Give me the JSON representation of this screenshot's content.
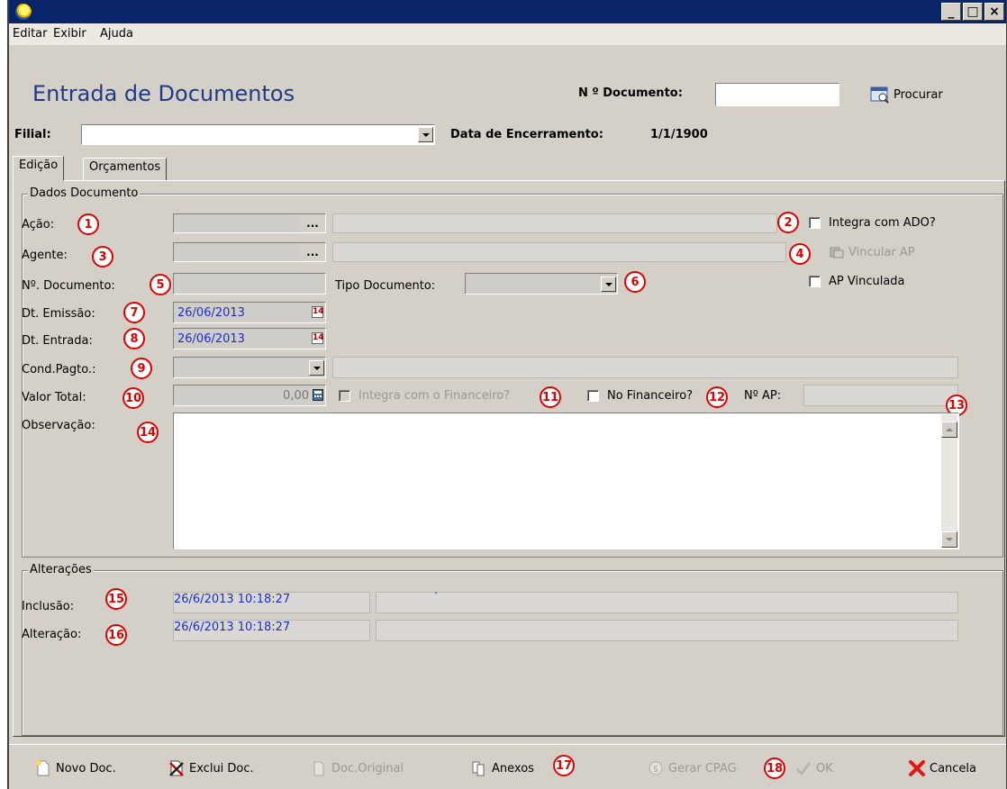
{
  "window": {
    "controls": [
      "_",
      "□",
      "×"
    ]
  },
  "menu": {
    "items": [
      "Editar",
      "Exibir",
      "Ajuda"
    ]
  },
  "header": {
    "title": "Entrada de Documentos",
    "doc_number_label": "N º Documento:",
    "doc_number_value": "",
    "search_label": "Procurar",
    "filial_label": "Filial:",
    "filial_value": "",
    "closing_date_label": "Data de Encerramento:",
    "closing_date_value": "1/1/1900"
  },
  "tabs": [
    {
      "label": "Edição",
      "active": true
    },
    {
      "label": "Orçamentos",
      "active": false
    }
  ],
  "dados": {
    "group_title": "Dados Documento",
    "acao_label": "Ação:",
    "acao_value": "",
    "agente_label": "Agente:",
    "agente_value": "",
    "ellipsis": "...",
    "integra_ado_label": "Integra com ADO?",
    "integra_ado_checked": false,
    "vincular_ap_label": "Vincular AP",
    "n_documento_label": "Nº. Documento:",
    "n_documento_value": "",
    "tipo_documento_label": "Tipo Documento:",
    "tipo_documento_value": "",
    "ap_vinculada_label": "AP Vinculada",
    "ap_vinculada_checked": false,
    "dt_emissao_label": "Dt. Emissão:",
    "dt_emissao_value": "26/06/2013",
    "dt_entrada_label": "Dt. Entrada:",
    "dt_entrada_value": "26/06/2013",
    "cond_pagto_label": "Cond.Pagto.:",
    "cond_pagto_value": "",
    "valor_total_label": "Valor Total:",
    "valor_total_value": "0,00",
    "integra_financeiro_label": "Integra com o Financeiro?",
    "integra_financeiro_checked": false,
    "no_financeiro_label": "No Financeiro?",
    "no_financeiro_checked": false,
    "n_ap_label": "Nº AP:",
    "n_ap_value": "",
    "observacao_label": "Observação:",
    "observacao_value": ""
  },
  "alteracoes": {
    "group_title": "Alterações",
    "inclusao_label": "Inclusão:",
    "inclusao_value": "26/6/2013 10:18:27",
    "inclusao_user": "·",
    "alteracao_label": "Alteração:",
    "alteracao_value": "26/6/2013 10:18:27",
    "alteracao_user": ""
  },
  "markers": [
    "1",
    "2",
    "3",
    "4",
    "5",
    "6",
    "7",
    "8",
    "9",
    "10",
    "11",
    "12",
    "13",
    "14",
    "15",
    "16",
    "17",
    "18"
  ],
  "toolbar": {
    "novo_doc": "Novo Doc.",
    "exclui_doc": "Exclui Doc.",
    "doc_original": "Doc.Original",
    "anexos": "Anexos",
    "gerar_cpag": "Gerar CPAG",
    "ok": "OK",
    "cancela": "Cancela"
  },
  "colors": {
    "title_bar": "#0a246a",
    "title_text": "#1f3b88",
    "date_text": "#1b2fd0",
    "marker": "#e00000"
  },
  "icons": {
    "app": "app-logo-icon",
    "search": "search-window-icon",
    "calendar": "calendar-icon",
    "calculator": "calculator-icon",
    "new_doc": "new-document-icon",
    "delete_doc": "delete-document-icon",
    "original_doc": "original-document-icon",
    "attachments": "attachments-icon",
    "cpag": "money-icon",
    "ok": "checkmark-icon",
    "cancel": "red-x-icon"
  }
}
